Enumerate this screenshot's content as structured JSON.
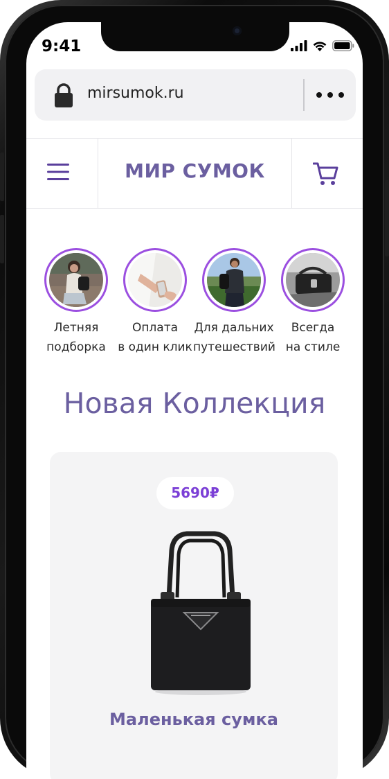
{
  "status_bar": {
    "time": "9:41"
  },
  "browser": {
    "url": "mirsumok.ru"
  },
  "header": {
    "logo": "МИР СУМОК"
  },
  "stories": [
    {
      "line1": "Летняя",
      "line2": "подборка"
    },
    {
      "line1": "Оплата",
      "line2": "в один клик"
    },
    {
      "line1": "Для дальних",
      "line2": "путешествий"
    },
    {
      "line1": "Всегда",
      "line2": "на стиле"
    }
  ],
  "section": {
    "title": "Новая Коллекция"
  },
  "product": {
    "price": "5690₽",
    "name": "Маленькая сумка"
  },
  "colors": {
    "accent": "#6b5fa0",
    "price": "#7b3fd6",
    "ring": "#9b4fe0"
  }
}
